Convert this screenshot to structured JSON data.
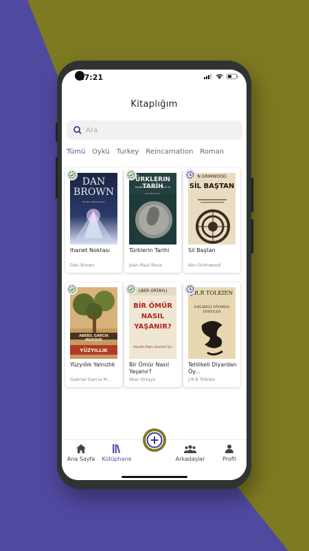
{
  "colors": {
    "background_left": "#5049a0",
    "background_right": "#7e7a22",
    "accent": "#5a4ea8",
    "fab_ring": "#7e7a22"
  },
  "status": {
    "time": "17:21"
  },
  "header": {
    "title": "Kitaplığım"
  },
  "search": {
    "placeholder": "Ara",
    "icon": "search-icon"
  },
  "tabs": [
    {
      "label": "Tümü",
      "active": true
    },
    {
      "label": "Öykü"
    },
    {
      "label": "Turkey"
    },
    {
      "label": "Reincarnation"
    },
    {
      "label": "Roman"
    }
  ],
  "books": [
    {
      "title": "Ihanet Noktası",
      "author": "Dan Brown",
      "status": "read",
      "cover_text": "DAN BROWN",
      "cover_sub": "Da Vinci Şifresi yazarı"
    },
    {
      "title": "Türklerin Tarihi",
      "author": "Jean-Paul Roux",
      "status": "read",
      "cover_text": "ÜRKLERIN TARİH",
      "cover_sub": "Pasifik'ten Akdeniz'e 2000 Yıl",
      "cover_author": "Jean-Paul Roux"
    },
    {
      "title": "Sil Baştan",
      "author": "Ken Grimwood",
      "status": "reading",
      "cover_text": "SİL BAŞTAN",
      "cover_author": "N GRIMWOOD"
    },
    {
      "title": "Yüzyıllık Yalnızlık",
      "author": "Gabriel Garcia M...",
      "status": "read",
      "cover_text": "YÜZYILLIK",
      "cover_author": "ABRİEL GARCIA MARQUE"
    },
    {
      "title": "Bir Ömür Nasıl Yaşanır?",
      "author": "İlber Ortaylı",
      "status": "read",
      "cover_text": "BİR ÖMÜR NASIL YAŞANIR?",
      "cover_sub": "Hayatta Doğru Seçimler İçin",
      "cover_author": "LBER ORTAYLI"
    },
    {
      "title": "Tehlikeli Diyardan Öy...",
      "author": "J.R.R Tolkien",
      "status": "reading",
      "cover_text": "EHLİKELİ DİYARDA ÖYKÜLER",
      "cover_author": "J.R.R TOLKIEN"
    }
  ],
  "nav": [
    {
      "label": "Ana Sayfa",
      "icon": "home-icon"
    },
    {
      "label": "Kütüphane",
      "icon": "library-icon",
      "active": true
    },
    {
      "label": "Arkadaşlar",
      "icon": "friends-icon"
    },
    {
      "label": "Profil",
      "icon": "profile-icon"
    }
  ],
  "fab": {
    "icon": "plus-icon"
  }
}
